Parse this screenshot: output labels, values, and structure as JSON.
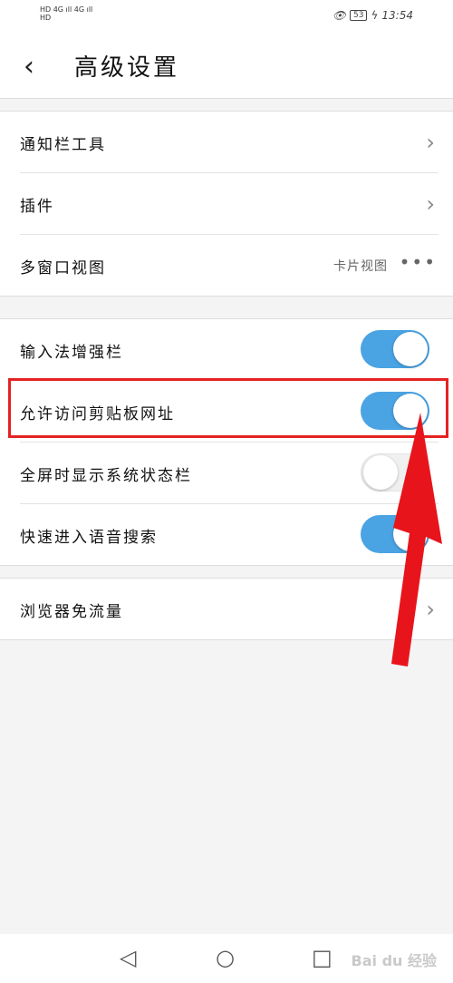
{
  "status_bar": {
    "left_line1": "HD 4G ıll 4G ıll",
    "left_line2": "HD",
    "battery": "53",
    "time": "13:54"
  },
  "header": {
    "back_glyph": "‹",
    "title": "高级设置"
  },
  "group1": [
    {
      "label": "通知栏工具"
    },
    {
      "label": "插件"
    },
    {
      "label": "多窗口视图",
      "value": "卡片视图",
      "more": "•••"
    }
  ],
  "group2": [
    {
      "label": "输入法增强栏",
      "on": true
    },
    {
      "label": "允许访问剪贴板网址",
      "on": true
    },
    {
      "label": "全屏时显示系统状态栏",
      "on": false
    },
    {
      "label": "快速进入语音搜索",
      "on": true
    }
  ],
  "group3": [
    {
      "label": "浏览器免流量"
    }
  ],
  "chevron": "›",
  "nav": {
    "back": "◁",
    "home": "○",
    "recents": "□"
  },
  "watermark": "Bai du 经验",
  "colors": {
    "toggle_on": "#4aa3e3",
    "highlight": "#e52222",
    "arrow": "#e8141c"
  }
}
